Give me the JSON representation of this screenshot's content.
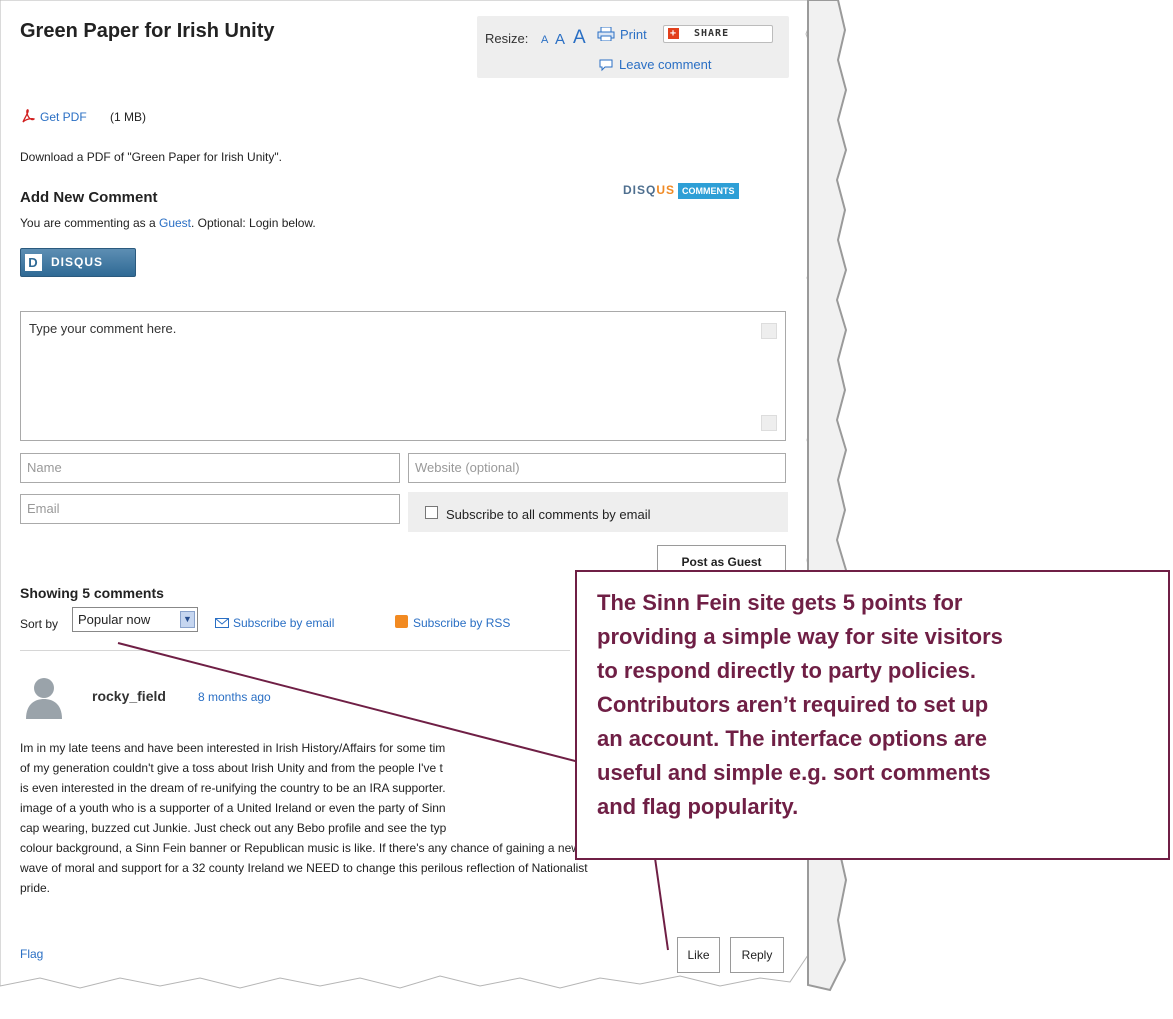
{
  "article": {
    "title": "Green Paper for Irish Unity",
    "resize_label": "Resize:",
    "resize_letters": [
      "A",
      "A",
      "A"
    ],
    "print_label": "Print",
    "share_label": "SHARE",
    "leave_comment_label": "Leave comment",
    "pdf_link": "Get PDF",
    "pdf_size": "(1 MB)",
    "pdf_description": "Download a PDF of \"Green Paper for Irish Unity\"."
  },
  "comment_form": {
    "heading": "Add New Comment",
    "disqus_badge_part1": "DISQ",
    "disqus_badge_part2": "US",
    "disqus_badge_part3": "COMMENTS",
    "commenting_as_prefix": "You are commenting as a ",
    "commenting_as_link": "Guest",
    "commenting_as_suffix": ". Optional: Login below.",
    "disqus_login_label": "DISQUS",
    "comment_placeholder": "Type your comment here.",
    "name_placeholder": "Name",
    "website_placeholder": "Website (optional)",
    "email_placeholder": "Email",
    "subscribe_label": "Subscribe to all comments by email",
    "subscribe_checked": false,
    "post_button": "Post as Guest"
  },
  "comments": {
    "count_label": "Showing 5 comments",
    "sort_label": "Sort by",
    "sort_value": "Popular now",
    "subscribe_email": "Subscribe by email",
    "subscribe_rss": "Subscribe by RSS",
    "items": [
      {
        "author": "rocky_field",
        "time": "8 months ago",
        "lines": [
          "Im in my late teens and have been interested in Irish History/Affairs for some tim",
          "of my generation couldn't give a toss about Irish Unity and from the people I've t",
          "is even interested in the dream of re-unifying the country to be an IRA supporter.",
          "image of a youth who is a supporter of a United Ireland or even the party of Sinn",
          "cap wearing, buzzed cut Junkie. Just check out any Bebo profile and see the typ",
          "colour background, a Sinn Fein banner or Republican music is like. If there's any chance of gaining a new",
          "wave of moral and support for a 32 county Ireland we NEED to change this perilous reflection of Nationalist",
          "pride."
        ],
        "flag_label": "Flag",
        "like_label": "Like",
        "reply_label": "Reply"
      }
    ]
  },
  "callout": {
    "lines": [
      "The Sinn Fein site gets 5 points for",
      "providing a simple way for site visitors",
      "to respond directly to party policies.",
      "Contributors aren’t required to set up",
      "an account. The interface options are",
      "useful and simple e.g. sort comments",
      "and flag popularity."
    ]
  },
  "colors": {
    "link": "#2a6fc4",
    "callout_border": "#6f1f45",
    "callout_text": "#6f1f45",
    "disqus_blue": "#2f6a95",
    "rss_orange": "#f28a21"
  }
}
